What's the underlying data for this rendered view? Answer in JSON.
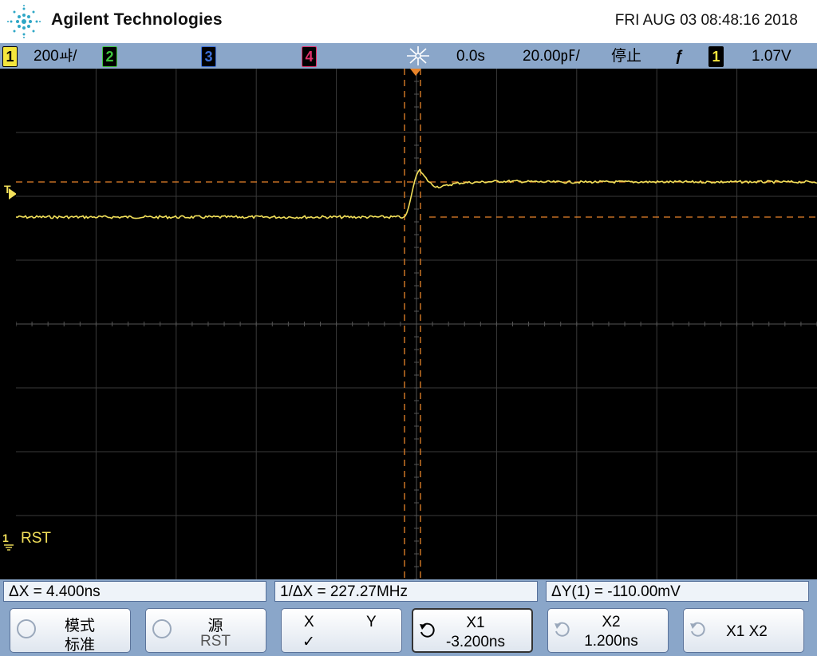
{
  "header": {
    "brand": "Agilent Technologies",
    "datetime": "FRI AUG 03 08:48:16 2018"
  },
  "statusbar": {
    "ch1": "1",
    "ch1_scale": "200ㆇ/",
    "ch2": "2",
    "ch3": "3",
    "ch4": "4",
    "delay": "0.0s",
    "timebase": "20.00㎊/",
    "run_state": "停止",
    "trigger_slope": "ƒ",
    "trigger_source": "1",
    "trigger_level": "1.07V"
  },
  "screen": {
    "trigger_marker": "T",
    "channel_marker": "1",
    "channel_label": "RST"
  },
  "measurements": {
    "delta_x": "ΔX = 4.400ns",
    "inv_delta_x": "1/ΔX = 227.27MHz",
    "delta_y": "ΔY(1) = -110.00mV"
  },
  "softkeys": {
    "mode_title": "模式",
    "mode_value": "标准",
    "source_title": "源",
    "source_value": "RST",
    "x_label": "X",
    "y_label": "Y",
    "check": "✓",
    "x1_title": "X1",
    "x1_value": "-3.200ns",
    "x2_title": "X2",
    "x2_value": "1.200ns",
    "x1x2": "X1 X2"
  },
  "colors": {
    "trace": "#f2e05a",
    "cursor": "#e8842a",
    "ch1": "#f5e63d",
    "ch2": "#3ec43e",
    "ch3": "#3c6fd8",
    "ch4": "#e0306a"
  }
}
